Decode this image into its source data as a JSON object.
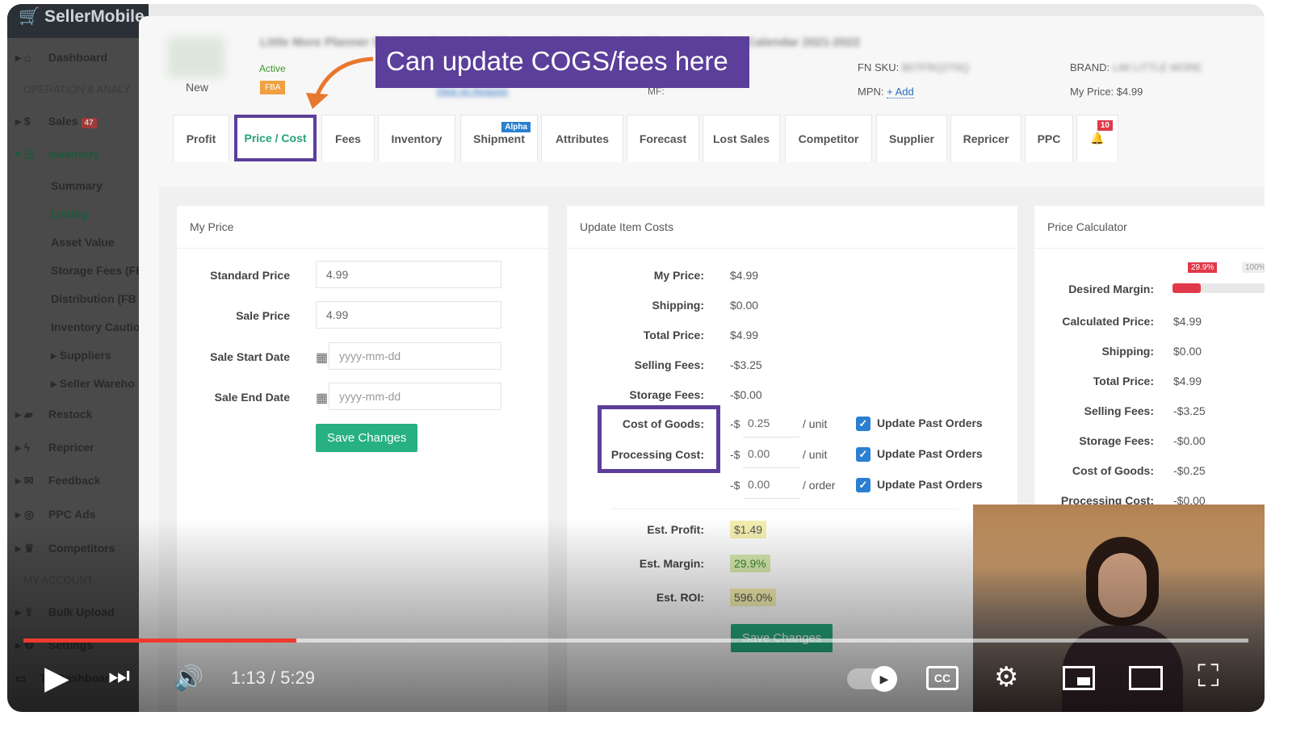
{
  "app": {
    "logo": "SellerMobile"
  },
  "sidebar": {
    "items": [
      {
        "label": "Dashboard",
        "icon": "home-icon"
      },
      {
        "section": "OPERATION & ANALY"
      },
      {
        "label": "Sales",
        "badge": "47",
        "icon": "dollar-icon"
      },
      {
        "label": "Inventory",
        "icon": "list-icon"
      },
      {
        "sub": "Summary"
      },
      {
        "sub": "Listing"
      },
      {
        "sub": "Asset Value"
      },
      {
        "sub": "Storage Fees (FB"
      },
      {
        "sub": "Distribution (FB"
      },
      {
        "sub": "Inventory Cautio"
      },
      {
        "sub": "Suppliers"
      },
      {
        "sub": "Seller Wareho"
      },
      {
        "label": "Restock",
        "icon": "truck-icon"
      },
      {
        "label": "Repricer",
        "icon": "bolt-icon"
      },
      {
        "label": "Feedback",
        "icon": "envelope-icon"
      },
      {
        "label": "PPC Ads",
        "icon": "target-icon"
      },
      {
        "label": "Competitors",
        "icon": "trophy-icon"
      },
      {
        "section": "MY ACCOUNT"
      },
      {
        "label": "Bulk Upload",
        "icon": "upload-icon"
      },
      {
        "label": "Settings",
        "icon": "gears-icon"
      },
      {
        "label": "TV Dashboard",
        "icon": "tv-icon"
      }
    ]
  },
  "product": {
    "condition": "New",
    "status": "Active",
    "channel": "FBA",
    "title": "Little More Planner Stickers - Functional Planners, Notebook - Monthly Index Tabs & Calendar 2021-2022",
    "view_link": "View on Amazon",
    "fn_sku_label": "FN SKU:",
    "fn_sku": "B07FRQ2T6Q",
    "mpn_label": "MPN:",
    "mpn_add": "+ Add",
    "brand_label": "BRAND:",
    "brand": "LIM LITTLE MORE",
    "my_price": "My Price: $4.99",
    "mf_label": "MF:"
  },
  "annotation": {
    "text": "Can update COGS/fees here",
    "color": "#5b3f9a",
    "arrow_color": "#e8772e"
  },
  "tabs": [
    {
      "label": "Profit"
    },
    {
      "label": "Price / Cost",
      "active": true
    },
    {
      "label": "Fees"
    },
    {
      "label": "Inventory"
    },
    {
      "label": "Shipment",
      "badge": "Alpha"
    },
    {
      "label": "Attributes"
    },
    {
      "label": "Forecast"
    },
    {
      "label": "Lost Sales"
    },
    {
      "label": "Competitor"
    },
    {
      "label": "Supplier"
    },
    {
      "label": "Repricer"
    },
    {
      "label": "PPC"
    },
    {
      "label": "",
      "icon": "bell-icon",
      "badge": "10"
    }
  ],
  "my_price": {
    "title": "My Price",
    "standard_label": "Standard Price",
    "standard": "4.99",
    "sale_label": "Sale Price",
    "sale": "4.99",
    "start_label": "Sale Start Date",
    "end_label": "Sale End Date",
    "date_placeholder": "yyyy-mm-dd",
    "save": "Save Changes"
  },
  "item_costs": {
    "title": "Update Item Costs",
    "rows": [
      {
        "label": "My Price:",
        "value": "$4.99"
      },
      {
        "label": "Shipping:",
        "value": "$0.00"
      },
      {
        "label": "Total Price:",
        "value": "$4.99"
      },
      {
        "label": "Selling Fees:",
        "value": "-$3.25"
      },
      {
        "label": "Storage Fees:",
        "value": "-$0.00"
      }
    ],
    "editable": [
      {
        "label": "Cost of Goods:",
        "prefix": "-$",
        "value": "0.25",
        "unit": "/ unit",
        "check": "Update Past Orders"
      },
      {
        "label": "Processing Cost:",
        "prefix": "-$",
        "value": "0.00",
        "unit": "/ unit",
        "check": "Update Past Orders"
      },
      {
        "label": "",
        "prefix": "-$",
        "value": "0.00",
        "unit": "/ order",
        "check": "Update Past Orders"
      }
    ],
    "profit_label": "Est. Profit:",
    "profit": "$1.49",
    "margin_label": "Est. Margin:",
    "margin": "29.9%",
    "roi_label": "Est. ROI:",
    "roi": "596.0%",
    "save": "Save Changes"
  },
  "calculator": {
    "title": "Price Calculator",
    "margin_badge": "29.9%",
    "max_badge": "100%",
    "desired_margin_label": "Desired Margin:",
    "desired_margin": 29.9,
    "rows": [
      {
        "label": "Calculated Price:",
        "value": "$4.99"
      },
      {
        "label": "Shipping:",
        "value": "$0.00"
      },
      {
        "label": "Total Price:",
        "value": "$4.99"
      },
      {
        "label": "Selling Fees:",
        "value": "-$3.25"
      },
      {
        "label": "Storage Fees:",
        "value": "-$0.00"
      },
      {
        "label": "Cost of Goods:",
        "value": "-$0.25"
      },
      {
        "label": "Processing Cost:",
        "value": "-$0.00"
      }
    ]
  },
  "player": {
    "time": "1:13 / 5:29",
    "progress": 22.3,
    "progress_color": "#f03a2c"
  }
}
